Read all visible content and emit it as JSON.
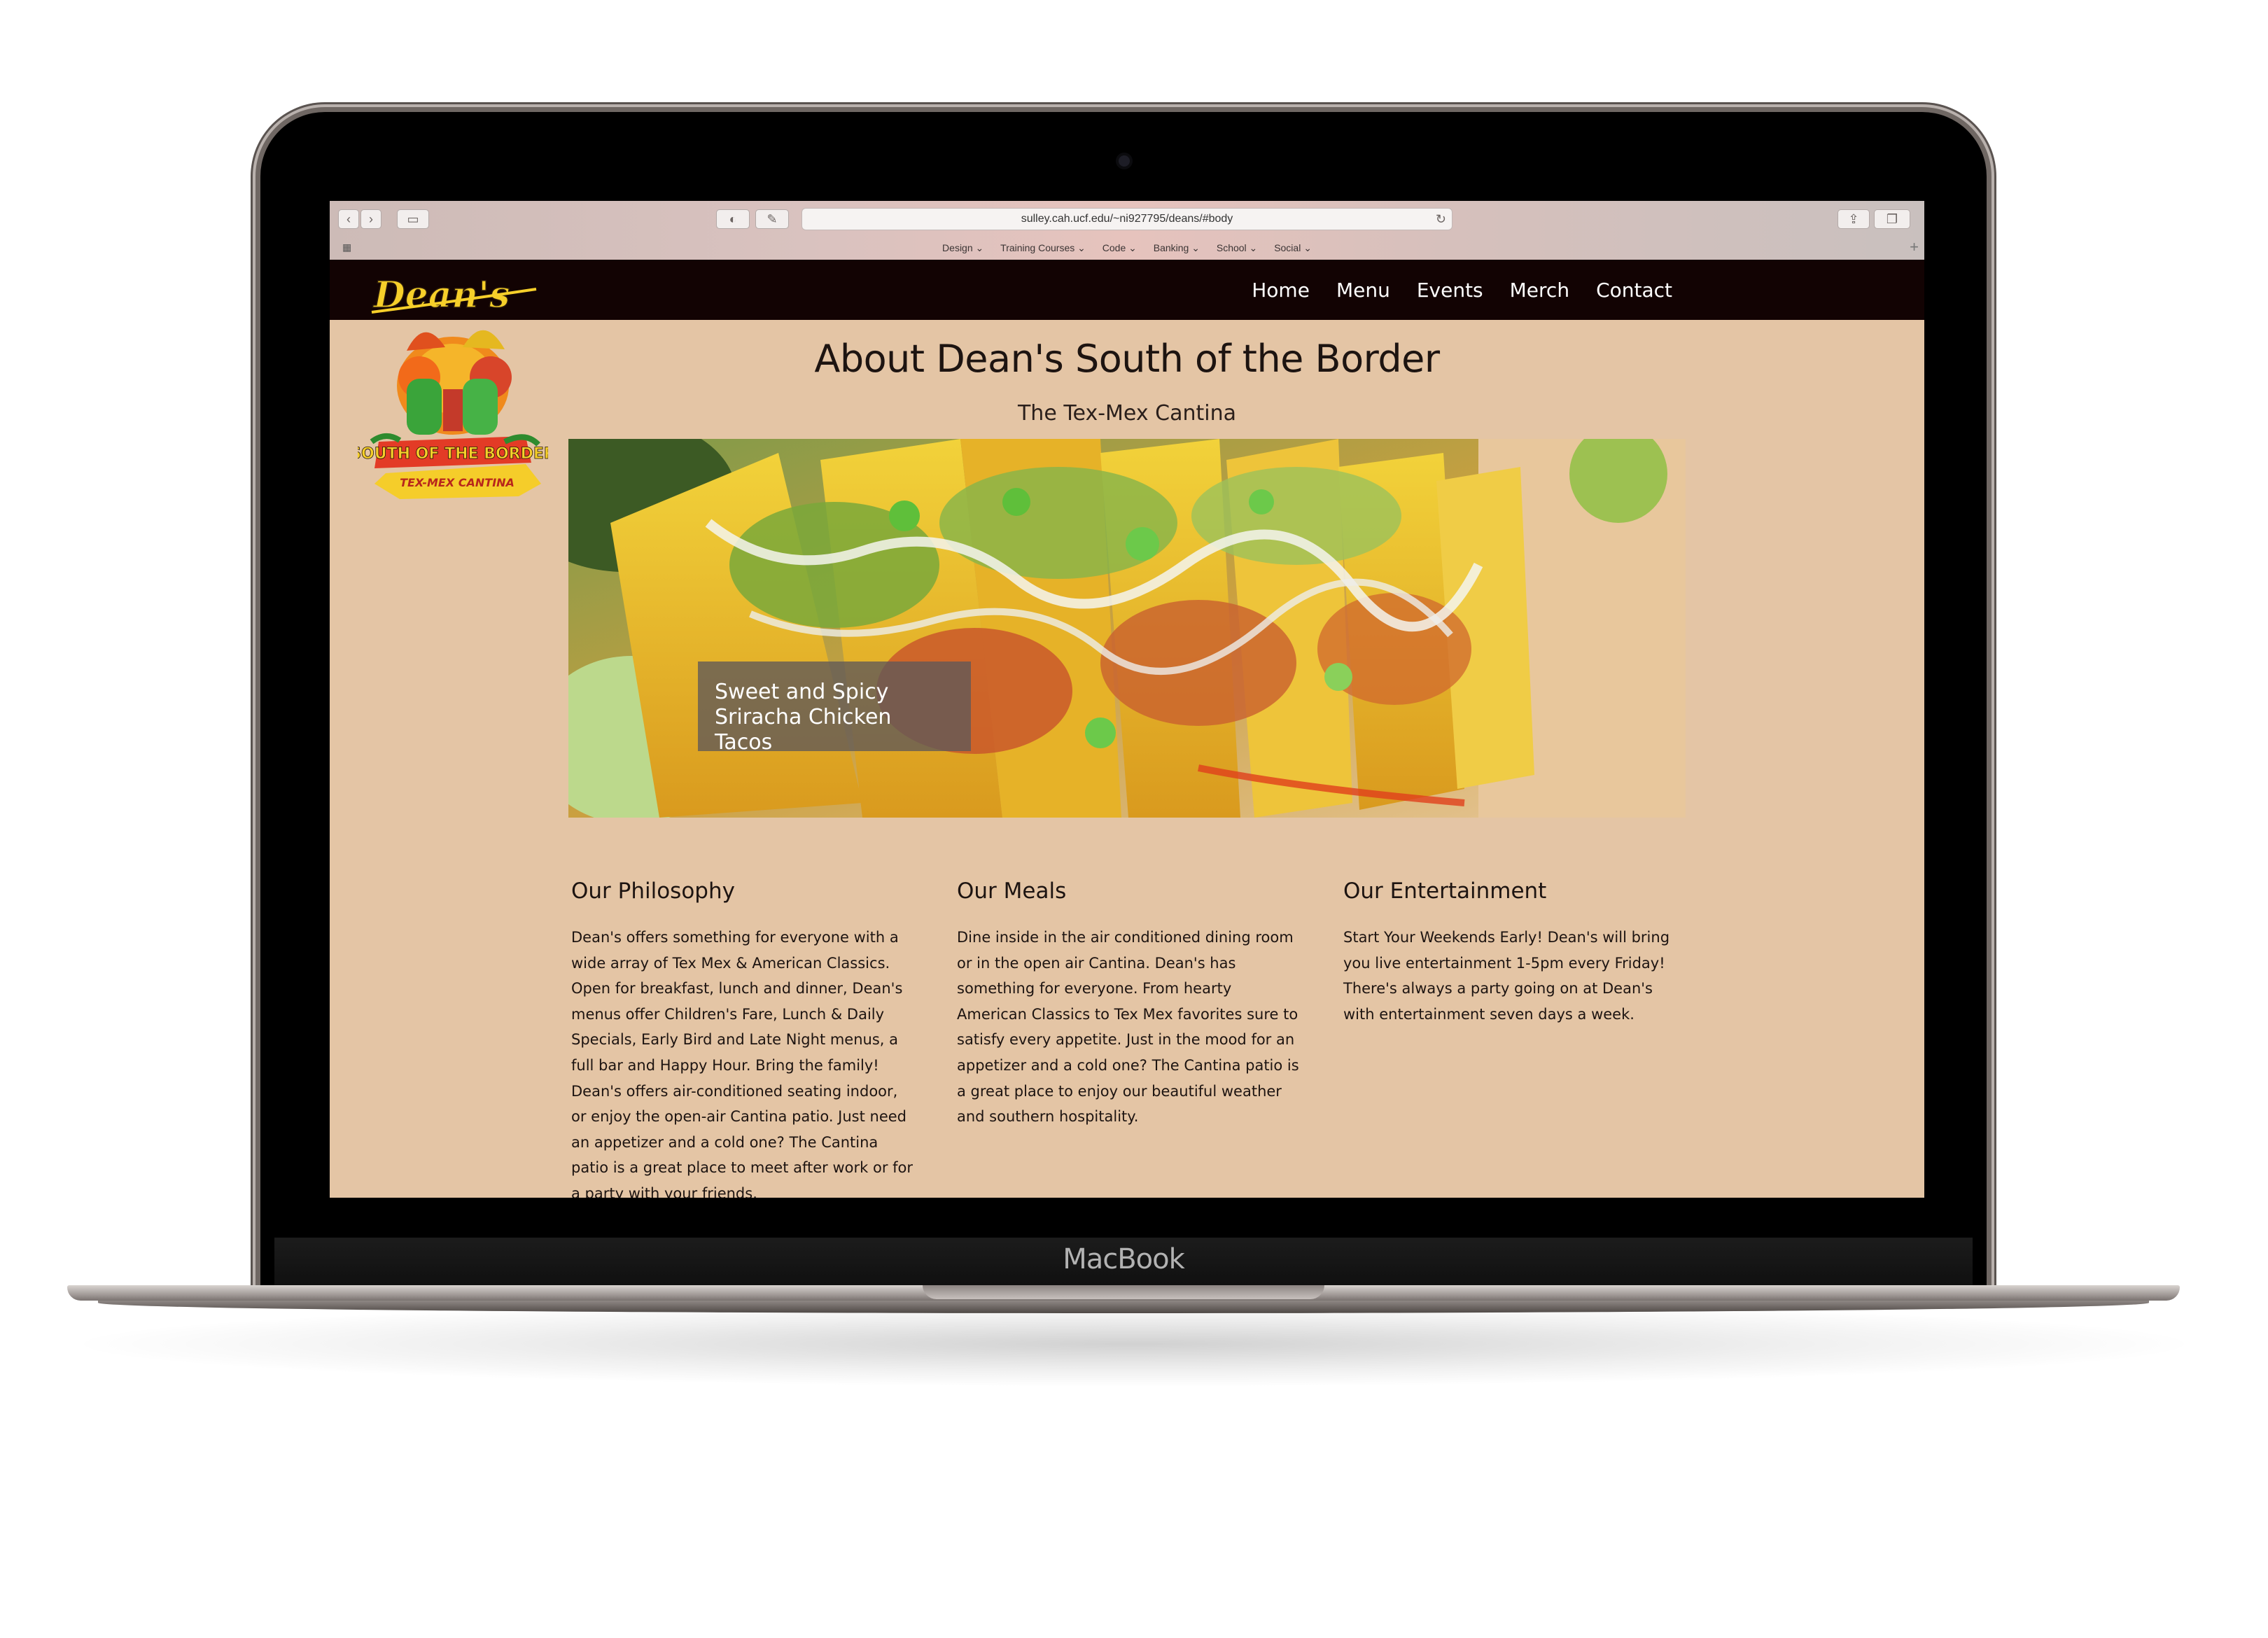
{
  "device": {
    "label": "MacBook"
  },
  "browser": {
    "url": "sulley.cah.ucf.edu/~ni927795/deans/#body",
    "bookmarks": [
      "Design",
      "Training Courses",
      "Code",
      "Banking",
      "School",
      "Social"
    ]
  },
  "site": {
    "logo": {
      "top_text": "Dean's",
      "banner_text": "SOUTH OF THE BORDER",
      "ribbon_text": "TEX-MEX CANTINA"
    },
    "nav": [
      "Home",
      "Menu",
      "Events",
      "Merch",
      "Contact"
    ],
    "title": "About Dean's South of the Border",
    "subtitle": "The Tex-Mex Cantina",
    "hero_caption": "Sweet and Spicy Sriracha Chicken Tacos",
    "sections": [
      {
        "heading": "Our Philosophy",
        "body": "Dean's offers something for everyone with a wide array of Tex Mex & American Classics. Open for breakfast, lunch and dinner, Dean's menus offer Children's Fare, Lunch & Daily Specials, Early Bird and Late Night menus, a full bar and Happy Hour. Bring the family! Dean's offers air-conditioned seating indoor, or enjoy the open-air Cantina patio. Just need an appetizer and a cold one? The Cantina patio is a great place to meet after work or for a party with your friends."
      },
      {
        "heading": "Our Meals",
        "body": "Dine inside in the air conditioned dining room or in the open air Cantina. Dean's has something for everyone. From hearty American Classics to Tex Mex favorites sure to satisfy every appetite. Just in the mood for an appetizer and a cold one? The Cantina patio is a great place to enjoy our beautiful weather and southern hospitality."
      },
      {
        "heading": "Our Entertainment",
        "body": "Start Your Weekends Early! Dean's will bring you live entertainment 1-5pm every Friday! There's always a party going on at Dean's with entertainment seven days a week."
      }
    ]
  },
  "colors": {
    "page_background": "#e4c5a5",
    "nav_background": "#120303",
    "text": "#1d1411"
  }
}
